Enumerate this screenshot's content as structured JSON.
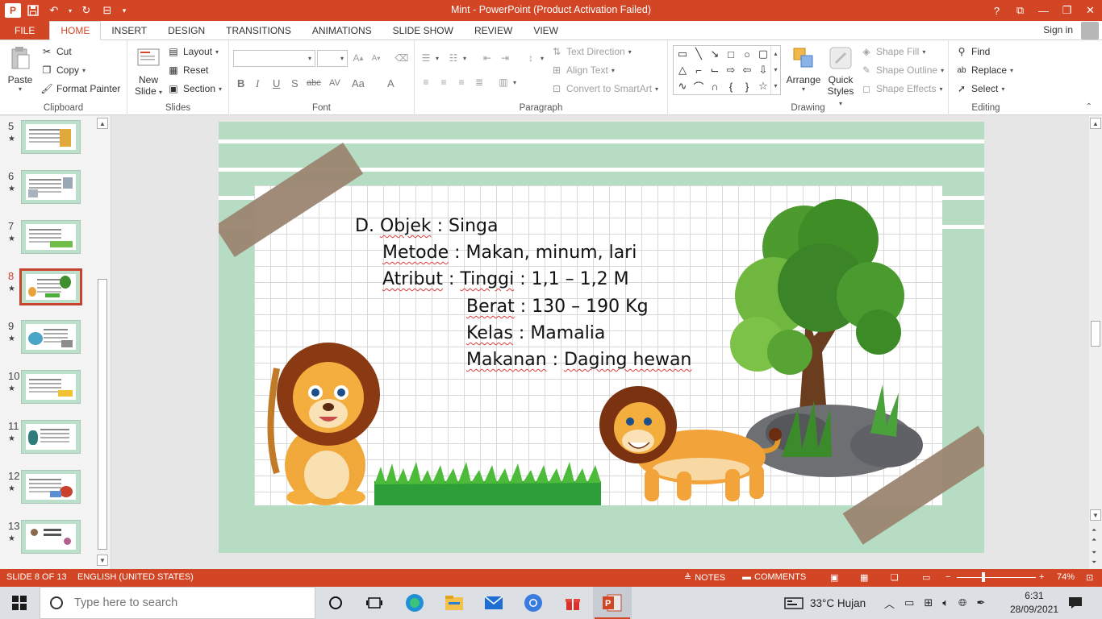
{
  "window": {
    "title": "Mint  -  PowerPoint (Product Activation Failed)",
    "app_badge": "P",
    "help": "?",
    "signin": "Sign in"
  },
  "ribbon_tabs": [
    "FILE",
    "HOME",
    "INSERT",
    "DESIGN",
    "TRANSITIONS",
    "ANIMATIONS",
    "SLIDE SHOW",
    "REVIEW",
    "VIEW"
  ],
  "ribbon_active_tab": "HOME",
  "clipboard": {
    "label": "Clipboard",
    "paste": "Paste",
    "cut": "Cut",
    "copy": "Copy",
    "format_painter": "Format Painter"
  },
  "slides_group": {
    "label": "Slides",
    "new_slide_1": "New",
    "new_slide_2": "Slide",
    "layout": "Layout",
    "reset": "Reset",
    "section": "Section"
  },
  "font_group": {
    "label": "Font",
    "bold": "B",
    "italic": "I",
    "underline": "U",
    "shadow": "S",
    "strike": "abc",
    "spacing": "AV",
    "case": "Aa",
    "color": "A"
  },
  "paragraph_group": {
    "label": "Paragraph",
    "text_direction": "Text Direction",
    "align_text": "Align Text",
    "convert_smartart": "Convert to SmartArt"
  },
  "drawing_group": {
    "label": "Drawing",
    "arrange": "Arrange",
    "quick_styles_1": "Quick",
    "quick_styles_2": "Styles",
    "shape_fill": "Shape Fill",
    "shape_outline": "Shape Outline",
    "shape_effects": "Shape Effects"
  },
  "editing_group": {
    "label": "Editing",
    "find": "Find",
    "replace": "Replace",
    "select": "Select"
  },
  "thumbnails": [
    {
      "num": "5",
      "star": "★"
    },
    {
      "num": "6",
      "star": "★"
    },
    {
      "num": "7",
      "star": "★"
    },
    {
      "num": "8",
      "star": "★",
      "selected": true
    },
    {
      "num": "9",
      "star": "★"
    },
    {
      "num": "10",
      "star": "★"
    },
    {
      "num": "11",
      "star": "★"
    },
    {
      "num": "12",
      "star": "★"
    },
    {
      "num": "13",
      "star": "★"
    }
  ],
  "slide": {
    "line1_prefix": "D. ",
    "line1_key": "Objek",
    "line1_val": " : Singa",
    "line2_key": "Metode",
    "line2_val": " : Makan, minum, lari",
    "line3_key": "Atribut",
    "line3_mid": " : ",
    "line3_key2": "Tinggi",
    "line3_val": " : 1,1 – 1,2 M",
    "line4_key": "Berat",
    "line4_val": " : 130 – 190 Kg",
    "line5_key": "Kelas",
    "line5_val": " : Mamalia",
    "line6_key": "Makanan",
    "line6_val": " : ",
    "line6_key2": "Daging hewan",
    "colors": {
      "background": "#b7dcc4",
      "text": "#111111",
      "tape": "#9a8571"
    }
  },
  "status": {
    "slide_of": "SLIDE 8 OF 13",
    "language": "ENGLISH (UNITED STATES)",
    "notes": "NOTES",
    "comments": "COMMENTS",
    "zoom": "74%",
    "zoom_minus": "−",
    "zoom_plus": "+"
  },
  "taskbar": {
    "search_placeholder": "Type here to search",
    "weather": "33°C  Hujan",
    "time": "6:31",
    "date": "28/09/2021"
  },
  "theme_colors": {
    "accent": "#d24625",
    "ribbon_bg": "#ffffff",
    "canvas_bg": "#e6e6e6"
  }
}
